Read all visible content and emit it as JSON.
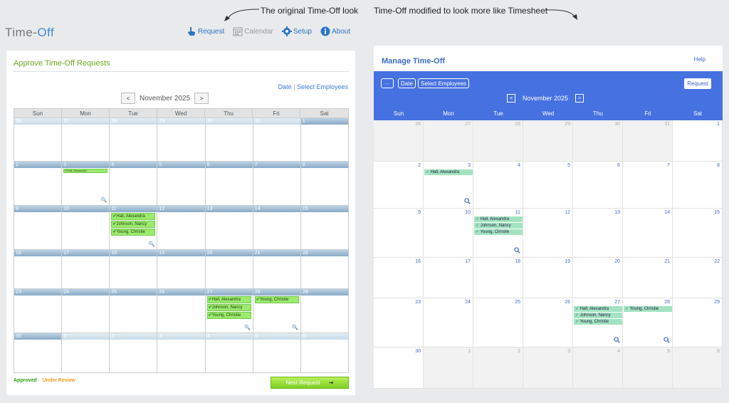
{
  "annotations": {
    "left": "The original Time-Off look",
    "right": "Time-Off modified to look more like Timesheet"
  },
  "logo": {
    "part1": "Time-",
    "part2": "Off"
  },
  "topnav": {
    "request": "Request",
    "calendar": "Calendar",
    "setup": "Setup",
    "about": "About"
  },
  "left": {
    "title": "Approve Time-Off Requests",
    "link_date": "Date",
    "link_sep": "|",
    "link_employees": "Select Employees",
    "month": "November 2025",
    "prev": "<",
    "next": ">",
    "dow": [
      "Sun",
      "Mon",
      "Tue",
      "Wed",
      "Thu",
      "Fri",
      "Sat"
    ],
    "legend_approved": "Approved",
    "legend_review": "Under Review",
    "next_request": "Next Request"
  },
  "right": {
    "title": "Manage Time-Off",
    "help": "Help",
    "menu_btn": "···",
    "date_btn": "Date",
    "employees_btn": "Select Employees",
    "request_btn": "Request",
    "month": "November 2025",
    "prev": "<",
    "next": ">",
    "dow": [
      "Sun",
      "Mon",
      "Tue",
      "Wed",
      "Thu",
      "Fri",
      "Sat"
    ]
  },
  "calendar": {
    "weeks": [
      {
        "days": [
          {
            "n": "26",
            "other": true
          },
          {
            "n": "27",
            "other": true
          },
          {
            "n": "28",
            "other": true
          },
          {
            "n": "29",
            "other": true
          },
          {
            "n": "30",
            "other": true
          },
          {
            "n": "31",
            "other": true
          },
          {
            "n": "1"
          }
        ]
      },
      {
        "days": [
          {
            "n": "2"
          },
          {
            "n": "3",
            "events": [
              "Hall, Alexandra"
            ],
            "mag": true
          },
          {
            "n": "4"
          },
          {
            "n": "5"
          },
          {
            "n": "6"
          },
          {
            "n": "7"
          },
          {
            "n": "8"
          }
        ]
      },
      {
        "days": [
          {
            "n": "9"
          },
          {
            "n": "10"
          },
          {
            "n": "11",
            "events": [
              "Hall, Alexandra",
              "Johnson, Nancy",
              "Young, Christie"
            ],
            "mag": true
          },
          {
            "n": "12"
          },
          {
            "n": "13"
          },
          {
            "n": "14"
          },
          {
            "n": "15"
          }
        ]
      },
      {
        "days": [
          {
            "n": "16"
          },
          {
            "n": "17"
          },
          {
            "n": "18"
          },
          {
            "n": "19"
          },
          {
            "n": "20"
          },
          {
            "n": "21"
          },
          {
            "n": "22"
          }
        ]
      },
      {
        "days": [
          {
            "n": "23"
          },
          {
            "n": "24"
          },
          {
            "n": "25"
          },
          {
            "n": "26"
          },
          {
            "n": "27",
            "events": [
              "Hall, Alexandra",
              "Johnson, Nancy",
              "Young, Christie"
            ],
            "mag": true
          },
          {
            "n": "28",
            "events": [
              "Young, Christie"
            ],
            "mag": true
          },
          {
            "n": "29"
          }
        ]
      },
      {
        "days": [
          {
            "n": "30"
          },
          {
            "n": "1",
            "other": true
          },
          {
            "n": "2",
            "other": true
          },
          {
            "n": "3",
            "other": true
          },
          {
            "n": "4",
            "other": true
          },
          {
            "n": "5",
            "other": true
          },
          {
            "n": "6",
            "other": true
          }
        ]
      }
    ]
  },
  "icons": {
    "check": "✔",
    "magnifier": "🔍",
    "arrow": "➔"
  }
}
